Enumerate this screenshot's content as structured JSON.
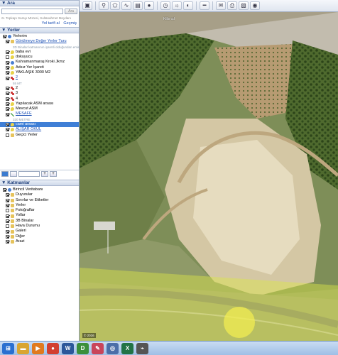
{
  "search": {
    "header": "▼ Ara",
    "placeholder": "",
    "button": "Ara",
    "hint": "ör. Topkapı Sarayı Müzesi, Sultanahmet Meydanı",
    "route_label": "Yol tarifi al",
    "history_label": "Geçmiş"
  },
  "places": {
    "header": "▼ Yerler",
    "items": [
      {
        "label": "Yerlerim",
        "checked": true,
        "icon": "globe-icon"
      },
      {
        "label": "Görülmeye Değer Yerler Turu",
        "checked": true,
        "icon": "folder-icon",
        "link": true
      },
      {
        "label": "3D Binalar katmanının işaretli olduğundan emin olun",
        "sub": true
      },
      {
        "label": "baba evi",
        "checked": true,
        "icon": "pin-icon"
      },
      {
        "label": "dokuyucu",
        "checked": false,
        "icon": "pin-icon"
      },
      {
        "label": "Kahramanmaraş Kroki Jkmz",
        "checked": true,
        "icon": "globe-icon"
      },
      {
        "label": "Adsız Yer İşareti",
        "checked": true,
        "icon": "pin-icon"
      },
      {
        "label": "YAKLAŞIK 3000 M2",
        "checked": true,
        "icon": "pin-icon"
      },
      {
        "label": "2",
        "checked": true,
        "icon": "dots-icon",
        "link": true
      },
      {
        "label": "55 MT",
        "sub": true
      },
      {
        "label": "2",
        "checked": true,
        "icon": "dots-icon"
      },
      {
        "label": "3",
        "checked": true,
        "icon": "dots-icon"
      },
      {
        "label": "4",
        "checked": true,
        "icon": "dots-icon"
      },
      {
        "label": "Yapılacak ASM arsası",
        "checked": true,
        "icon": "pin-icon"
      },
      {
        "label": "Mevcut ASM",
        "checked": true,
        "icon": "pin-icon"
      },
      {
        "label": "MESAFE",
        "checked": true,
        "icon": "path-icon",
        "link": true
      },
      {
        "label": "320 METRE",
        "sub": true
      },
      {
        "label": "cami arsası",
        "checked": true,
        "icon": "pin-icon",
        "selected": true
      },
      {
        "label": "ALIŞAR OKUL",
        "checked": true,
        "icon": "pin-icon",
        "link": true
      },
      {
        "label": "Geçici Yerler",
        "checked": false,
        "icon": "folder-icon"
      }
    ]
  },
  "tools": {
    "add": "+",
    "up": "+"
  },
  "layers": {
    "header": "▼ Katmanlar",
    "items": [
      {
        "label": "Birincil Veritabanı",
        "checked": true,
        "icon": "globe-icon"
      },
      {
        "label": "Duyurular",
        "checked": true,
        "icon": "folder-icon"
      },
      {
        "label": "Sınırlar ve Etiketler",
        "checked": true,
        "icon": "folder-icon"
      },
      {
        "label": "Yerler",
        "checked": true,
        "icon": "folder-icon"
      },
      {
        "label": "Fotoğraflar",
        "checked": false,
        "icon": "folder-icon"
      },
      {
        "label": "Yollar",
        "checked": true,
        "icon": "folder-icon"
      },
      {
        "label": "3B Binalar",
        "checked": true,
        "icon": "folder-icon"
      },
      {
        "label": "Hava Durumu",
        "checked": false,
        "icon": "folder-icon"
      },
      {
        "label": "Galeri",
        "checked": true,
        "icon": "folder-icon"
      },
      {
        "label": "Diğer",
        "checked": true,
        "icon": "folder-icon"
      },
      {
        "label": "Arazi",
        "checked": true,
        "icon": "folder-icon"
      }
    ]
  },
  "map": {
    "top_label": "Kilis cd",
    "scale": "© 2016"
  },
  "taskbar": {
    "apps": [
      {
        "name": "start-orb-icon",
        "glyph": "⊞",
        "color": "#2a6fd0"
      },
      {
        "name": "folder-icon",
        "glyph": "▬",
        "color": "#d9a531"
      },
      {
        "name": "media-player-icon",
        "glyph": "▶",
        "color": "#e07a1f"
      },
      {
        "name": "chrome-icon",
        "glyph": "●",
        "color": "#d23f31"
      },
      {
        "name": "word-icon",
        "glyph": "W",
        "color": "#2b579a"
      },
      {
        "name": "d-app-icon",
        "glyph": "D",
        "color": "#3b8f3b"
      },
      {
        "name": "paint-icon",
        "glyph": "✎",
        "color": "#c9455a"
      },
      {
        "name": "earth-icon",
        "glyph": "◎",
        "color": "#4b6ea8"
      },
      {
        "name": "excel-icon",
        "glyph": "X",
        "color": "#217346"
      },
      {
        "name": "usb-icon",
        "glyph": "⌁",
        "color": "#555"
      }
    ]
  }
}
